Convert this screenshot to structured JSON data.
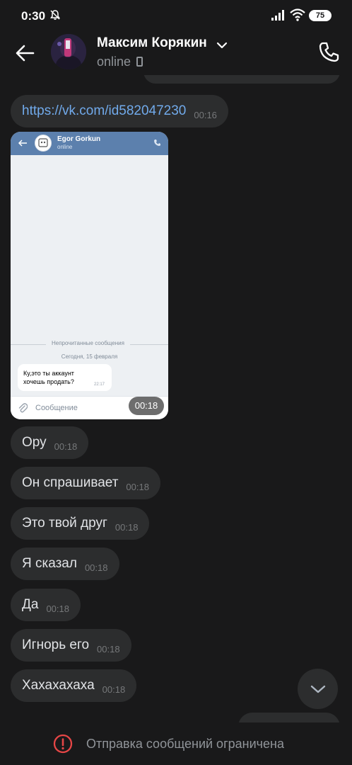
{
  "status_bar": {
    "time": "0:30",
    "battery": "75",
    "icons": [
      "bell-off-icon",
      "signal-icon",
      "wifi-icon",
      "battery-icon"
    ]
  },
  "header": {
    "contact_name": "Максим Корякин",
    "status": "online",
    "icons": [
      "back-arrow-icon",
      "chevron-down-icon",
      "phone-device-icon",
      "phone-call-icon"
    ]
  },
  "messages": [
    {
      "type": "link",
      "text": "https://vk.com/id582047230",
      "time": "00:16"
    },
    {
      "type": "photo",
      "time": "00:18"
    },
    {
      "type": "text",
      "text": "Ору",
      "time": "00:18"
    },
    {
      "type": "text",
      "text": "Он спрашивает",
      "time": "00:18"
    },
    {
      "type": "text",
      "text": "Это твой друг",
      "time": "00:18"
    },
    {
      "type": "text",
      "text": "Я сказал",
      "time": "00:18"
    },
    {
      "type": "text",
      "text": "Да",
      "time": "00:18"
    },
    {
      "type": "text",
      "text": "Игнорь его",
      "time": "00:18"
    },
    {
      "type": "text",
      "text": "Хахахахаха",
      "time": "00:18"
    }
  ],
  "screenshot": {
    "contact_name": "Egor Gorkun",
    "status": "online",
    "unread_label": "Непрочитанные сообщения",
    "date_label": "Сегодня, 15 февраля",
    "message_text": "Ку,это ты аккаунт хочешь продать?",
    "message_time": "22:17",
    "composer_placeholder": "Сообщение"
  },
  "footer": {
    "notice": "Отправка сообщений ограничена",
    "icon": "warning-circle-icon"
  },
  "colors": {
    "background": "#19191a",
    "bubble": "#2c2d2e",
    "link": "#71aaeb",
    "warning": "#e64646"
  }
}
